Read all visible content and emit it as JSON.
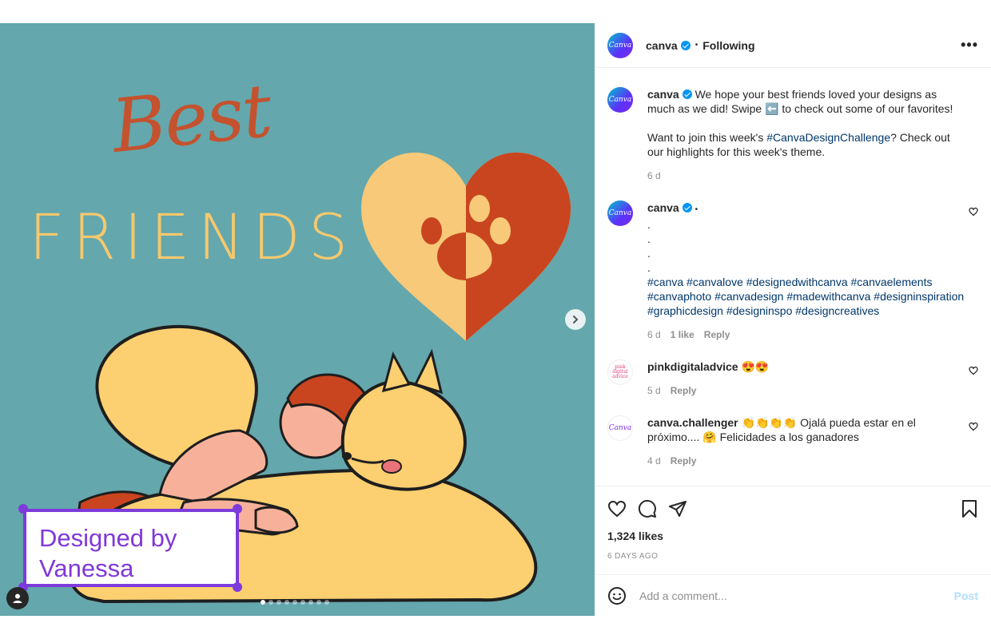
{
  "media": {
    "title_best": "Best",
    "title_friends": "FRIENDS",
    "credit_line1": "Designed by",
    "credit_line2": "Vanessa",
    "carousel_count": 9,
    "carousel_active": 0
  },
  "header": {
    "username": "canva",
    "separator": "•",
    "following_label": "Following",
    "more_label": "•••"
  },
  "caption": {
    "username": "canva",
    "text1": "We hope your best friends loved your designs as much as we did! Swipe ⬅️ to check out some of our favorites!",
    "text2_prefix": "Want to join this week's ",
    "text2_tag": "#CanvaDesignChallenge",
    "text2_suffix": "? Check out our highlights for this week's theme.",
    "time": "6 d"
  },
  "comments": [
    {
      "username": "canva",
      "dot_lines": [
        "•",
        ".",
        ".",
        ".",
        "."
      ],
      "hashtags": "#canva #canvalove #designedwithcanva #canvaelements #canvaphoto #canvadesign #madewithcanva #designinspiration #graphicdesign #designinspo #designcreatives",
      "time": "6 d",
      "likes": "1 like",
      "reply": "Reply"
    },
    {
      "username": "pinkdigitaladvice",
      "text": "😍😍",
      "time": "5 d",
      "reply": "Reply"
    },
    {
      "username": "canva.challenger",
      "text": "👏👏👏👏 Ojalá pueda estar en el próximo.... 🤗 Felicidades a los ganadores",
      "time": "4 d",
      "reply": "Reply"
    }
  ],
  "avatars": {
    "canva_text": "Canva",
    "pink_text": "pink digital advice",
    "challenger_text": "Canva"
  },
  "actions": {
    "likes": "1,324 likes",
    "posted": "6 DAYS AGO"
  },
  "add_comment": {
    "placeholder": "Add a comment...",
    "post_label": "Post"
  },
  "icons": [
    "heart-icon",
    "comment-icon",
    "share-icon",
    "bookmark-icon",
    "emoji-icon",
    "chevron-right-icon",
    "user-tag-icon",
    "more-icon"
  ]
}
